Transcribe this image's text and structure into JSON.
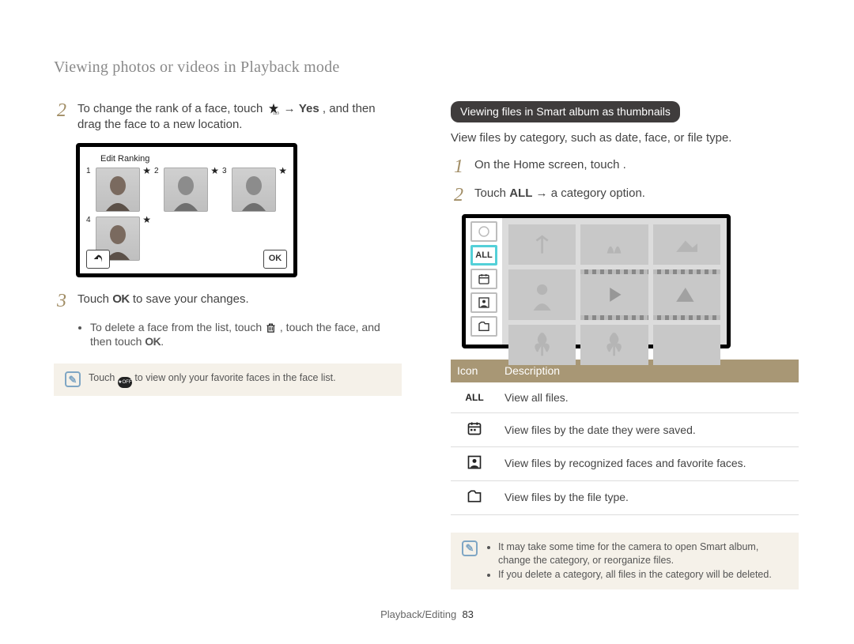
{
  "page_title": "Viewing photos or videos in Playback mode",
  "left": {
    "step2": {
      "num": "2",
      "pre": "To change the rank of a face, touch ",
      "mid_arrow": " → ",
      "strong": "Yes",
      "post": ", and then drag the face to a new location."
    },
    "edit_ranking_title": "Edit Ranking",
    "faces": [
      "1",
      "2",
      "3",
      "4"
    ],
    "back_label": "↶",
    "ok_label": "OK",
    "step3": {
      "num": "3",
      "pre": "Touch ",
      "ok_glyph": "OK",
      "post": " to save your changes."
    },
    "bullet_delete_1": "To delete a face from the list, touch ",
    "bullet_delete_2": ", touch the face, and then touch ",
    "bullet_delete_ok": "OK",
    "note_text_1": "Touch ",
    "note_text_2": " to view only your favorite faces in the face list."
  },
  "right": {
    "heading": "Viewing files in Smart album as thumbnails",
    "desc": "View files by category, such as date, face, or file type.",
    "step1": {
      "num": "1",
      "text": "On the Home screen, touch      ."
    },
    "step2": {
      "num": "2",
      "pre": "Touch ",
      "strong": "ALL",
      "arrow": " → ",
      "post": "a category option."
    },
    "sidebar_all": "ALL",
    "table": {
      "h1": "Icon",
      "h2": "Description",
      "rows": [
        {
          "icon": "ALL",
          "desc": "View all files."
        },
        {
          "icon": "calendar",
          "desc": "View files by the date they were saved."
        },
        {
          "icon": "face-frame",
          "desc": "View files by recognized faces and favorite faces."
        },
        {
          "icon": "folder",
          "desc": "View files by the file type."
        }
      ]
    },
    "note": {
      "li1": "It may take some time for the camera to open Smart album, change the category, or reorganize files.",
      "li2": "If you delete a category, all files in the category will be deleted."
    }
  },
  "footer": {
    "section": "Playback/Editing",
    "page": "83"
  }
}
